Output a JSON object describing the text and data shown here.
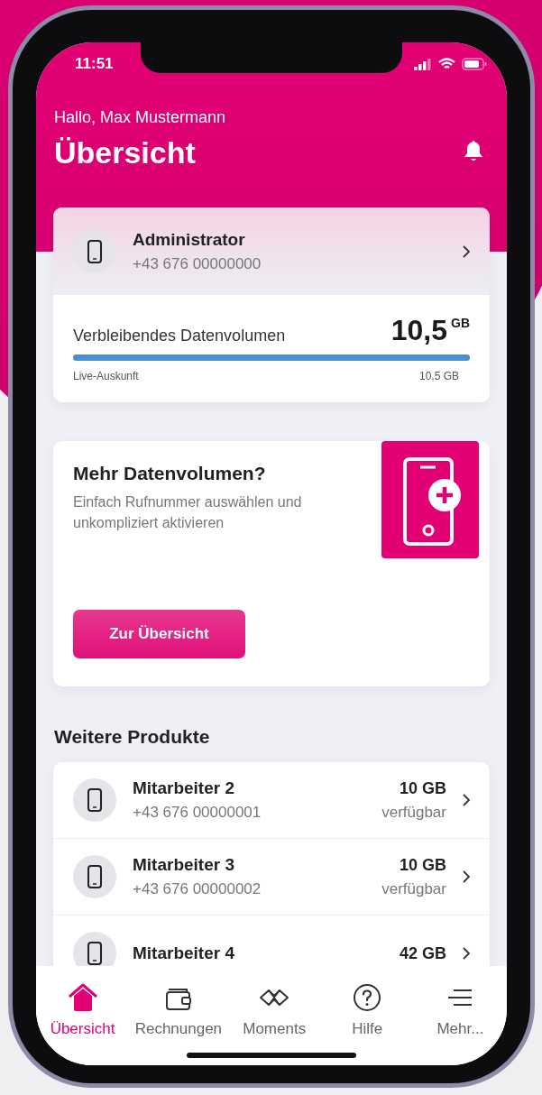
{
  "status_bar": {
    "time": "11:51"
  },
  "header": {
    "greeting": "Hallo, Max Mustermann",
    "title": "Übersicht"
  },
  "main_line": {
    "name": "Administrator",
    "number": "+43 676 00000000",
    "data_label": "Verbleibendes Datenvolumen",
    "data_value": "10,5",
    "data_unit": "GB",
    "level": 1,
    "footer_left": "Live-Auskunft",
    "footer_right": "10,5 GB"
  },
  "promo": {
    "title": "Mehr Datenvolumen?",
    "text": "Einfach Rufnummer auswählen und unkompliziert aktivieren",
    "button": "Zur Übersicht"
  },
  "products": {
    "title": "Weitere Produkte",
    "items": [
      {
        "name": "Mitarbeiter 2",
        "number": "+43 676 00000001",
        "amount": "10 GB",
        "status": "verfügbar"
      },
      {
        "name": "Mitarbeiter 3",
        "number": "+43 676 00000002",
        "amount": "10 GB",
        "status": "verfügbar"
      },
      {
        "name": "Mitarbeiter 4",
        "amount": "42 GB"
      }
    ]
  },
  "tab_bar": [
    {
      "label": "Übersicht",
      "kind": "home",
      "selected": true
    },
    {
      "label": "Rechnungen",
      "kind": "wallet",
      "selected": false
    },
    {
      "label": "Moments",
      "kind": "moments",
      "selected": false
    },
    {
      "label": "Hilfe",
      "kind": "help",
      "selected": false
    },
    {
      "label": "Mehr...",
      "kind": "menu",
      "selected": false
    }
  ]
}
